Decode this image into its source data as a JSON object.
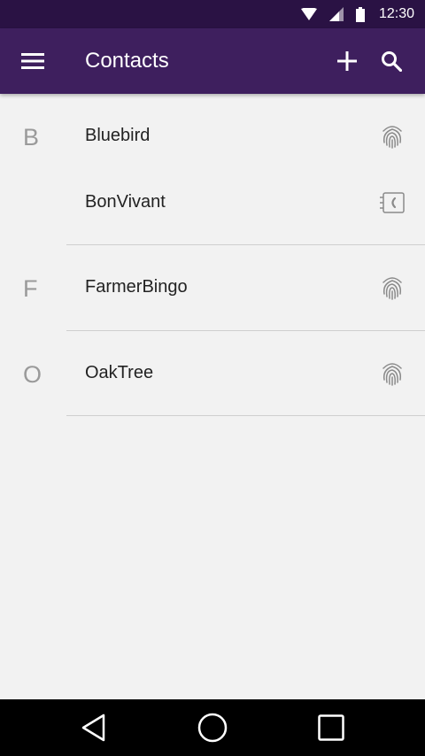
{
  "status_bar": {
    "time": "12:30",
    "icons": [
      "wifi-icon",
      "cell-signal-icon",
      "battery-icon"
    ]
  },
  "app_bar": {
    "title": "Contacts",
    "icons": [
      "menu-icon",
      "add-icon",
      "search-icon"
    ]
  },
  "sections": [
    {
      "letter": "B",
      "contacts": [
        {
          "name": "Bluebird",
          "icon": "fingerprint-icon"
        },
        {
          "name": "BonVivant",
          "icon": "contact-phone-icon"
        }
      ]
    },
    {
      "letter": "F",
      "contacts": [
        {
          "name": "FarmerBingo",
          "icon": "fingerprint-icon"
        }
      ]
    },
    {
      "letter": "O",
      "contacts": [
        {
          "name": "OakTree",
          "icon": "fingerprint-icon"
        }
      ]
    }
  ],
  "nav_bar": {
    "icons": [
      "back-icon",
      "home-icon",
      "recents-icon"
    ]
  },
  "colors": {
    "status_bar": "#2a1244",
    "app_bar": "#3e1f5e",
    "background": "#f2f2f2",
    "section_letter": "#9a9a9a",
    "divider": "#cfcfcf",
    "contact_icon": "#8a8a8a"
  }
}
